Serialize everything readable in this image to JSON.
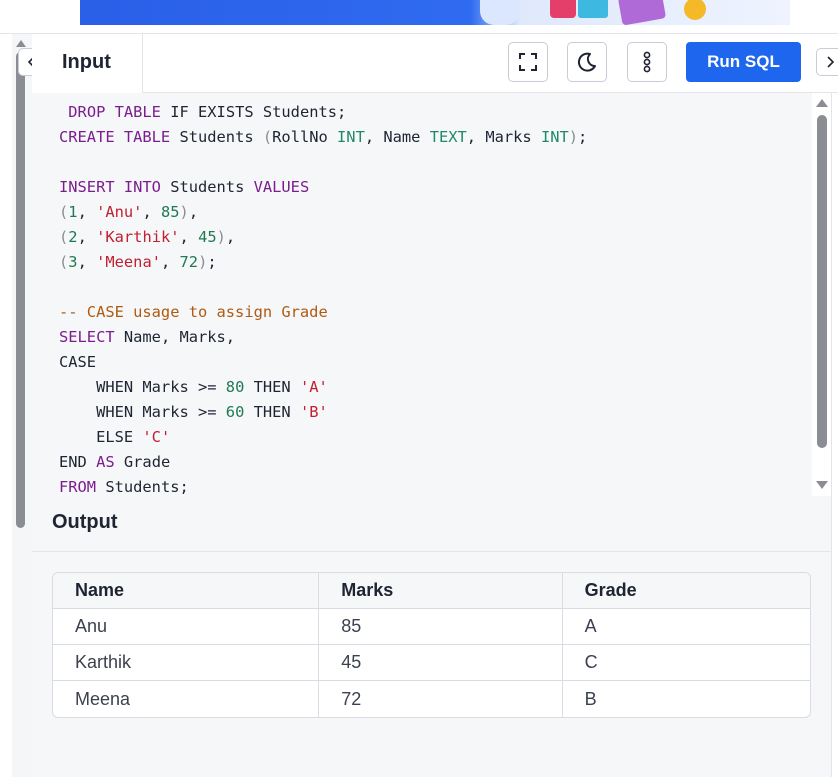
{
  "tabs": {
    "input_label": "Input"
  },
  "toolbar": {
    "run_label": "Run SQL",
    "fullscreen_icon": "fullscreen-icon",
    "theme_icon": "moon-icon",
    "more_icon": "more-vertical-icon"
  },
  "nav": {
    "prev_icon": "chevron-left-icon",
    "next_icon": "chevron-right-icon"
  },
  "editor": {
    "lines": [
      [
        {
          "t": " "
        },
        {
          "t": "DROP TABLE",
          "c": "kw"
        },
        {
          "t": " IF EXISTS Students;"
        }
      ],
      [
        {
          "t": "CREATE TABLE",
          "c": "kw"
        },
        {
          "t": " Students "
        },
        {
          "t": "(",
          "c": "pn"
        },
        {
          "t": "RollNo "
        },
        {
          "t": "INT",
          "c": "ty"
        },
        {
          "t": ", Name "
        },
        {
          "t": "TEXT",
          "c": "ty"
        },
        {
          "t": ", Marks "
        },
        {
          "t": "INT",
          "c": "ty"
        },
        {
          "t": ")",
          "c": "pn"
        },
        {
          "t": ";"
        }
      ],
      [
        {
          "t": ""
        }
      ],
      [
        {
          "t": "INSERT INTO",
          "c": "kw"
        },
        {
          "t": " Students "
        },
        {
          "t": "VALUES",
          "c": "kw"
        }
      ],
      [
        {
          "t": "(",
          "c": "pn"
        },
        {
          "t": "1",
          "c": "num"
        },
        {
          "t": ", "
        },
        {
          "t": "'Anu'",
          "c": "str"
        },
        {
          "t": ", "
        },
        {
          "t": "85",
          "c": "num"
        },
        {
          "t": ")",
          "c": "pn"
        },
        {
          "t": ","
        }
      ],
      [
        {
          "t": "(",
          "c": "pn"
        },
        {
          "t": "2",
          "c": "num"
        },
        {
          "t": ", "
        },
        {
          "t": "'Karthik'",
          "c": "str"
        },
        {
          "t": ", "
        },
        {
          "t": "45",
          "c": "num"
        },
        {
          "t": ")",
          "c": "pn"
        },
        {
          "t": ","
        }
      ],
      [
        {
          "t": "(",
          "c": "pn"
        },
        {
          "t": "3",
          "c": "num"
        },
        {
          "t": ", "
        },
        {
          "t": "'Meena'",
          "c": "str"
        },
        {
          "t": ", "
        },
        {
          "t": "72",
          "c": "num"
        },
        {
          "t": ")",
          "c": "pn"
        },
        {
          "t": ";"
        }
      ],
      [
        {
          "t": ""
        }
      ],
      [
        {
          "t": "-- CASE usage to assign Grade",
          "c": "cm"
        }
      ],
      [
        {
          "t": "SELECT",
          "c": "kw"
        },
        {
          "t": " Name, Marks,"
        }
      ],
      [
        {
          "t": "CASE"
        }
      ],
      [
        {
          "t": "    WHEN Marks >= "
        },
        {
          "t": "80",
          "c": "num"
        },
        {
          "t": " THEN "
        },
        {
          "t": "'A'",
          "c": "str"
        }
      ],
      [
        {
          "t": "    WHEN Marks >= "
        },
        {
          "t": "60",
          "c": "num"
        },
        {
          "t": " THEN "
        },
        {
          "t": "'B'",
          "c": "str"
        }
      ],
      [
        {
          "t": "    ELSE "
        },
        {
          "t": "'C'",
          "c": "str"
        }
      ],
      [
        {
          "t": "END "
        },
        {
          "t": "AS",
          "c": "kw"
        },
        {
          "t": " Grade"
        }
      ],
      [
        {
          "t": "FROM",
          "c": "kw"
        },
        {
          "t": " Students;"
        }
      ]
    ]
  },
  "output": {
    "title": "Output",
    "columns": [
      "Name",
      "Marks",
      "Grade"
    ],
    "rows": [
      [
        "Anu",
        "85",
        "A"
      ],
      [
        "Karthik",
        "45",
        "C"
      ],
      [
        "Meena",
        "72",
        "B"
      ]
    ]
  },
  "colors": {
    "accent": "#1e66ee",
    "keyword": "#7b1d8e",
    "type": "#1f8a63",
    "string": "#c02030",
    "comment": "#b05a10"
  }
}
